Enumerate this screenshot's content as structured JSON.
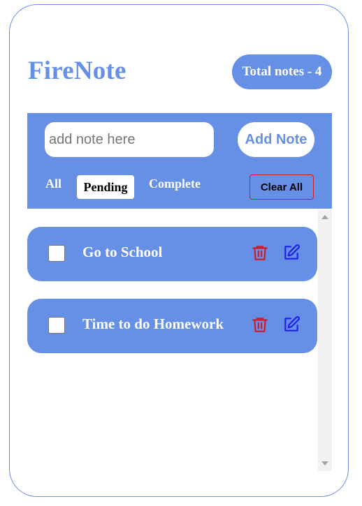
{
  "app": {
    "title": "FireNote",
    "total_notes_label": "Total notes - 4"
  },
  "input": {
    "placeholder": "add note here",
    "value": ""
  },
  "actions": {
    "add_label": "Add Note",
    "clear_label": "Clear All"
  },
  "filters": [
    {
      "label": "All",
      "selected": false
    },
    {
      "label": "Pending",
      "selected": true
    },
    {
      "label": "Complete",
      "selected": false
    }
  ],
  "notes": [
    {
      "text": "Go to School",
      "checked": false
    },
    {
      "text": "Time to do Homework",
      "checked": false
    }
  ],
  "colors": {
    "accent": "#6690e6",
    "delete_icon": "#d11a2a",
    "edit_icon": "#1f1fe8"
  },
  "icons": {
    "delete": "trash-icon",
    "edit": "pencil-edit-icon"
  }
}
